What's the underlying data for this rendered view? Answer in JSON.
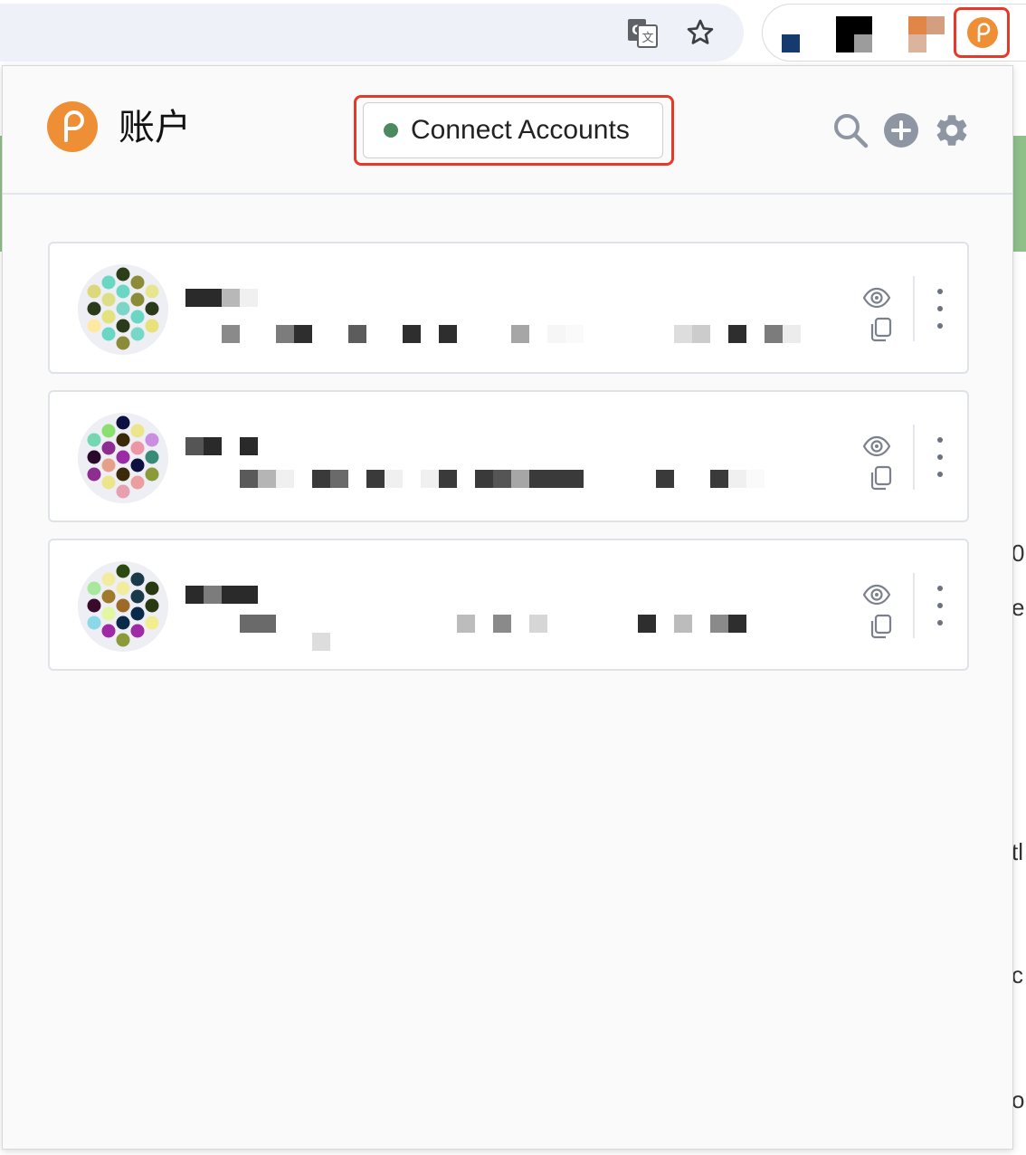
{
  "header": {
    "title": "账户",
    "connect_label": "Connect Accounts",
    "connect_dot_color": "#4c8b5f",
    "icons": [
      "search-icon",
      "add-account-icon",
      "settings-gear-icon"
    ]
  },
  "browser": {
    "omnibox_icons": [
      "translate-icon",
      "bookmark-star-icon"
    ],
    "extension_icons": [
      "extension-blue-square-icon",
      "extension-black-icon",
      "extension-orange-icon",
      "polkadot-extension-icon"
    ],
    "highlight_color": "#e53a2b"
  },
  "background_page_fragments": [
    "0",
    "el",
    "tl",
    "c",
    "or"
  ],
  "accounts": [
    {
      "identicon_colors": [
        "#2c3e18",
        "#6ad7c4",
        "#8c8c38",
        "#ddd87a",
        "#6ad7c4",
        "#e7e68f",
        "#dede86",
        "#8c8c38",
        "#2a3a1a",
        "#7cd6c6",
        "#2a3a1a",
        "#e2e27f",
        "#6ad7c4",
        "#ffe8a0",
        "#2a3a1a",
        "#e8e27a",
        "#6ad7c4",
        "#78d8c8",
        "#8c8c38"
      ],
      "name_pixels": [
        "#2a2a2a",
        "#2a2a2a",
        "#b8b8b8",
        "#f0f0f0"
      ],
      "address_pixels": [
        "",
        "",
        "#8a8a8a",
        "",
        "",
        "#7c7c7c",
        "#2e2e2e",
        "",
        "",
        "#5c5c5c",
        "",
        "",
        "#2e2e2e",
        "",
        "#2e2e2e",
        "",
        "",
        "",
        "#a6a6a6",
        "",
        "#f6f6f6",
        "#fafafa",
        "",
        "",
        "",
        "",
        "",
        "#dddddd",
        "#cccccc",
        "",
        "#2e2e2e",
        "",
        "#7c7c7c",
        "#ececec"
      ],
      "address_pixels_2": []
    },
    {
      "identicon_colors": [
        "#0b1040",
        "#8ae06e",
        "#ece58c",
        "#72d8b2",
        "#3b2a0a",
        "#c98ee0",
        "#8e2d90",
        "#ec96a6",
        "#2a0a2a",
        "#9b2ca6",
        "#3a8a7a",
        "#e6a08a",
        "#0b1040",
        "#8e2d90",
        "#3b2a0a",
        "#8c9a3a",
        "#ece58c",
        "#ea9e9e",
        "#e6a0b0"
      ],
      "name_pixels": [
        "#555555",
        "#2a2a2a",
        "",
        "#2a2a2a"
      ],
      "address_pixels": [
        "",
        "",
        "",
        "#5a5a5a",
        "#b5b5b5",
        "#f0f0f0",
        "",
        "#3a3a3a",
        "#6a6a6a",
        "",
        "#3a3a3a",
        "#f0f0f0",
        "",
        "#f0f0f0",
        "#3a3a3a",
        "",
        "#3a3a3a",
        "#555555",
        "#a6a6a6",
        "#3a3a3a",
        "#3a3a3a",
        "#3a3a3a",
        "",
        "",
        "",
        "",
        "#3a3a3a",
        "",
        "",
        "#3a3a3a",
        "#f0f0f0",
        "#fafafa"
      ],
      "address_pixels_2": []
    },
    {
      "identicon_colors": [
        "#2a4a10",
        "#f1ec9e",
        "#1a3a4a",
        "#a8e89a",
        "#f1ec9e",
        "#2a3a10",
        "#9e7a2a",
        "#1a3a4a",
        "#3a0a2a",
        "#9e6a2a",
        "#2a3a10",
        "#e2f7a0",
        "#0a2a4a",
        "#8ad8e8",
        "#0a2a4a",
        "#f2ee8e",
        "#9e2aa6",
        "#9e2aa6",
        "#8c9a3a"
      ],
      "name_pixels": [
        "#2a2a2a",
        "#7c7c7c",
        "#2a2a2a",
        "#2a2a2a"
      ],
      "address_pixels": [
        "",
        "",
        "",
        "#6a6a6a",
        "#6a6a6a",
        "",
        "",
        "",
        "",
        "",
        "",
        "",
        "",
        "",
        "",
        "#bcbcbc",
        "",
        "#8a8a8a",
        "",
        "#d6d6d6",
        "",
        "",
        "",
        "",
        "",
        "#2e2e2e",
        "",
        "#bcbcbc",
        "",
        "#8a8a8a",
        "#2e2e2e"
      ],
      "address_pixels_2": [
        "",
        "",
        "",
        "",
        "",
        "",
        "",
        "#dddddd"
      ]
    }
  ]
}
